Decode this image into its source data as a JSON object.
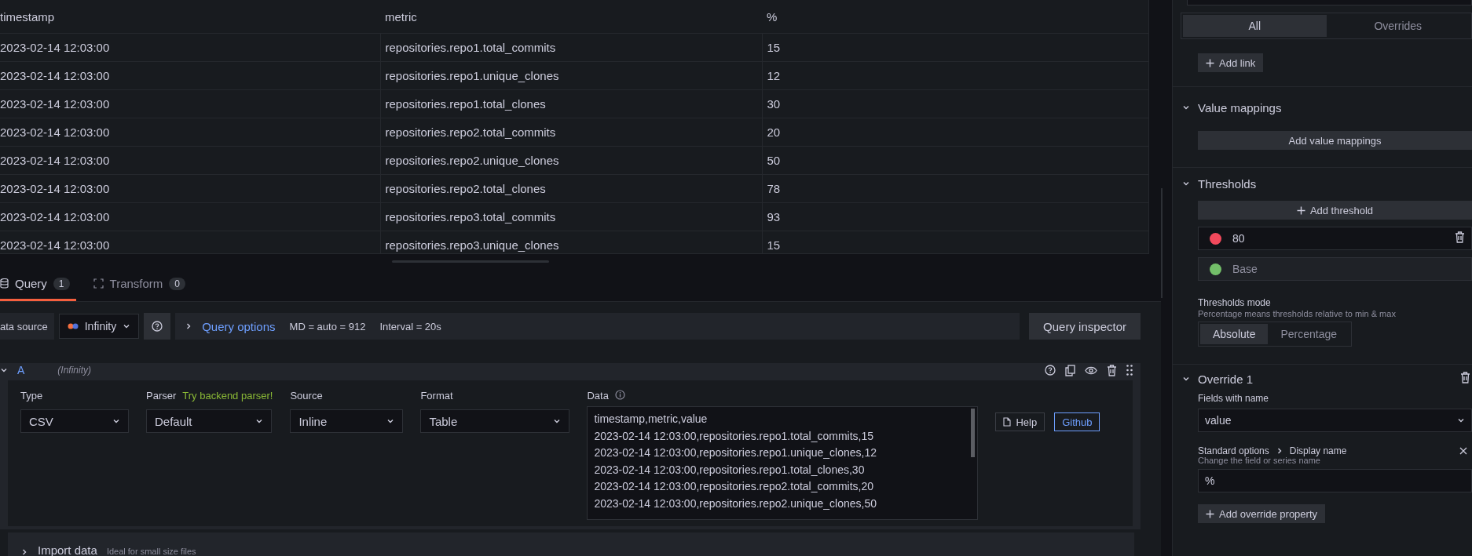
{
  "table": {
    "columns": [
      "timestamp",
      "metric",
      "%"
    ],
    "rows": [
      [
        "2023-02-14 12:03:00",
        "repositories.repo1.total_commits",
        "15"
      ],
      [
        "2023-02-14 12:03:00",
        "repositories.repo1.unique_clones",
        "12"
      ],
      [
        "2023-02-14 12:03:00",
        "repositories.repo1.total_clones",
        "30"
      ],
      [
        "2023-02-14 12:03:00",
        "repositories.repo2.total_commits",
        "20"
      ],
      [
        "2023-02-14 12:03:00",
        "repositories.repo2.unique_clones",
        "50"
      ],
      [
        "2023-02-14 12:03:00",
        "repositories.repo2.total_clones",
        "78"
      ],
      [
        "2023-02-14 12:03:00",
        "repositories.repo3.total_commits",
        "93"
      ],
      [
        "2023-02-14 12:03:00",
        "repositories.repo3.unique_clones",
        "15"
      ]
    ]
  },
  "query_tabs": [
    {
      "label": "Query",
      "count": "1",
      "selected": true
    },
    {
      "label": "Transform",
      "count": "0",
      "selected": false
    }
  ],
  "query_bar": {
    "data_source_label": "ata source",
    "data_source": "Infinity",
    "query_options": "Query options",
    "max_data_points": "MD = auto = 912",
    "interval": "Interval = 20s",
    "inspector_button": "Query inspector"
  },
  "query": {
    "ref_id": "A",
    "datasource": "(Infinity)",
    "fields": [
      {
        "label": "Type",
        "value": "CSV"
      },
      {
        "label": "Parser",
        "hint": "Try backend parser!",
        "value": "Default"
      },
      {
        "label": "Source",
        "value": "Inline"
      },
      {
        "label": "Format",
        "value": "Table"
      }
    ],
    "data_label": "Data",
    "data_lines": [
      "timestamp,metric,value",
      "2023-02-14 12:03:00,repositories.repo1.total_commits,15",
      "2023-02-14 12:03:00,repositories.repo1.unique_clones,12",
      "2023-02-14 12:03:00,repositories.repo1.total_clones,30",
      "2023-02-14 12:03:00,repositories.repo2.total_commits,20",
      "2023-02-14 12:03:00,repositories.repo2.unique_clones,50"
    ],
    "buttons": [
      {
        "label": "Help",
        "kind": "secondary"
      },
      {
        "label": "Github",
        "kind": "outline"
      }
    ]
  },
  "import_data": {
    "title": "Import data",
    "hint": "Ideal for small size files"
  },
  "options": {
    "tabs": [
      {
        "label": "All",
        "selected": true
      },
      {
        "label": "Overrides",
        "selected": false
      }
    ],
    "add_link": "Add link",
    "value_mappings": {
      "title": "Value mappings",
      "expanded": true,
      "button": "Add value mappings"
    },
    "thresholds": {
      "title": "Thresholds",
      "expanded": true,
      "add_button": "Add threshold",
      "steps": [
        {
          "value": "80",
          "color": "#f2495c",
          "kind": "value"
        },
        {
          "value": "Base",
          "color": "#73bf69",
          "kind": "base"
        }
      ],
      "mode_label": "Thresholds mode",
      "mode_description": "Percentage means thresholds relative to min & max",
      "modes": [
        {
          "label": "Absolute",
          "selected": true
        },
        {
          "label": "Percentage",
          "selected": false
        }
      ]
    },
    "override": {
      "title": "Override 1",
      "expanded": true,
      "matcher_label": "Fields with name",
      "matcher_value": "value",
      "property_path": [
        "Standard options",
        "Display name"
      ],
      "property_description": "Change the field or series name",
      "property_value": "%",
      "add_property": "Add override property"
    }
  }
}
